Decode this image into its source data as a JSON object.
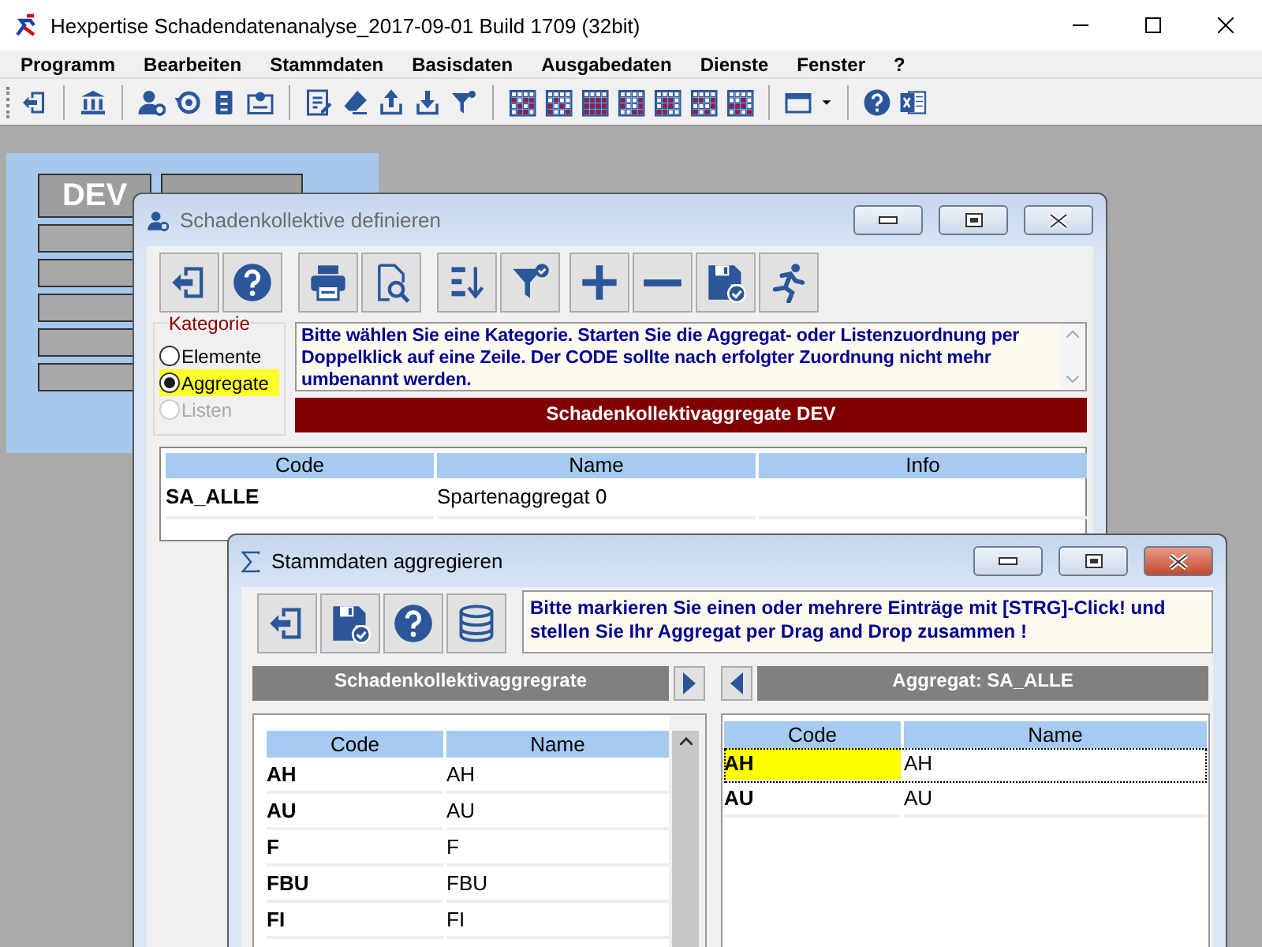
{
  "app": {
    "title": "Hexpertise Schadendatenanalyse_2017-09-01 Build 1709 (32bit)"
  },
  "menu": [
    "Programm",
    "Bearbeiten",
    "Stammdaten",
    "Basisdaten",
    "Ausgabedaten",
    "Dienste",
    "Fenster",
    "?"
  ],
  "background_panel": {
    "label": "DEV"
  },
  "window_1": {
    "title": "Schadenkollektive definieren",
    "active": false,
    "category": {
      "label": "Kategorie",
      "options": [
        {
          "label": "Elemente",
          "selected": false,
          "disabled": false,
          "highlighted": false
        },
        {
          "label": "Aggregate",
          "selected": true,
          "disabled": false,
          "highlighted": true
        },
        {
          "label": "Listen",
          "selected": false,
          "disabled": true,
          "highlighted": false
        }
      ]
    },
    "info": "Bitte wählen Sie eine Kategorie. Starten Sie die Aggregat- oder Listenzuordnung per Doppelklick auf eine Zeile. Der CODE sollte nach erfolgter Zuordnung nicht mehr umbenannt werden.",
    "banner": "Schadenkollektivaggregate DEV",
    "table": {
      "columns": [
        "Code",
        "Name",
        "Info"
      ],
      "rows": [
        {
          "code": "SA_ALLE",
          "name": "Spartenaggregat 0"
        }
      ]
    }
  },
  "window_2": {
    "title": "Stammdaten aggregieren",
    "active": true,
    "info": "Bitte markieren Sie einen oder mehrere Einträge mit [STRG]-Click! und stellen Sie Ihr Aggregat per Drag and Drop zusammen !",
    "left": {
      "header": "Schadenkollektivaggregrate",
      "columns": [
        "Code",
        "Name"
      ],
      "rows": [
        {
          "code": "AH",
          "name": "AH",
          "selected": false
        },
        {
          "code": "AU",
          "name": "AU",
          "selected": false
        },
        {
          "code": "F",
          "name": "F",
          "selected": false
        },
        {
          "code": "FBU",
          "name": "FBU",
          "selected": false
        },
        {
          "code": "FI",
          "name": "FI",
          "selected": false
        }
      ]
    },
    "right": {
      "header": "Aggregat: SA_ALLE",
      "columns": [
        "Code",
        "Name"
      ],
      "rows": [
        {
          "code": "AH",
          "name": "AH",
          "selected": true
        },
        {
          "code": "AU",
          "name": "AU",
          "selected": false
        }
      ]
    }
  }
}
